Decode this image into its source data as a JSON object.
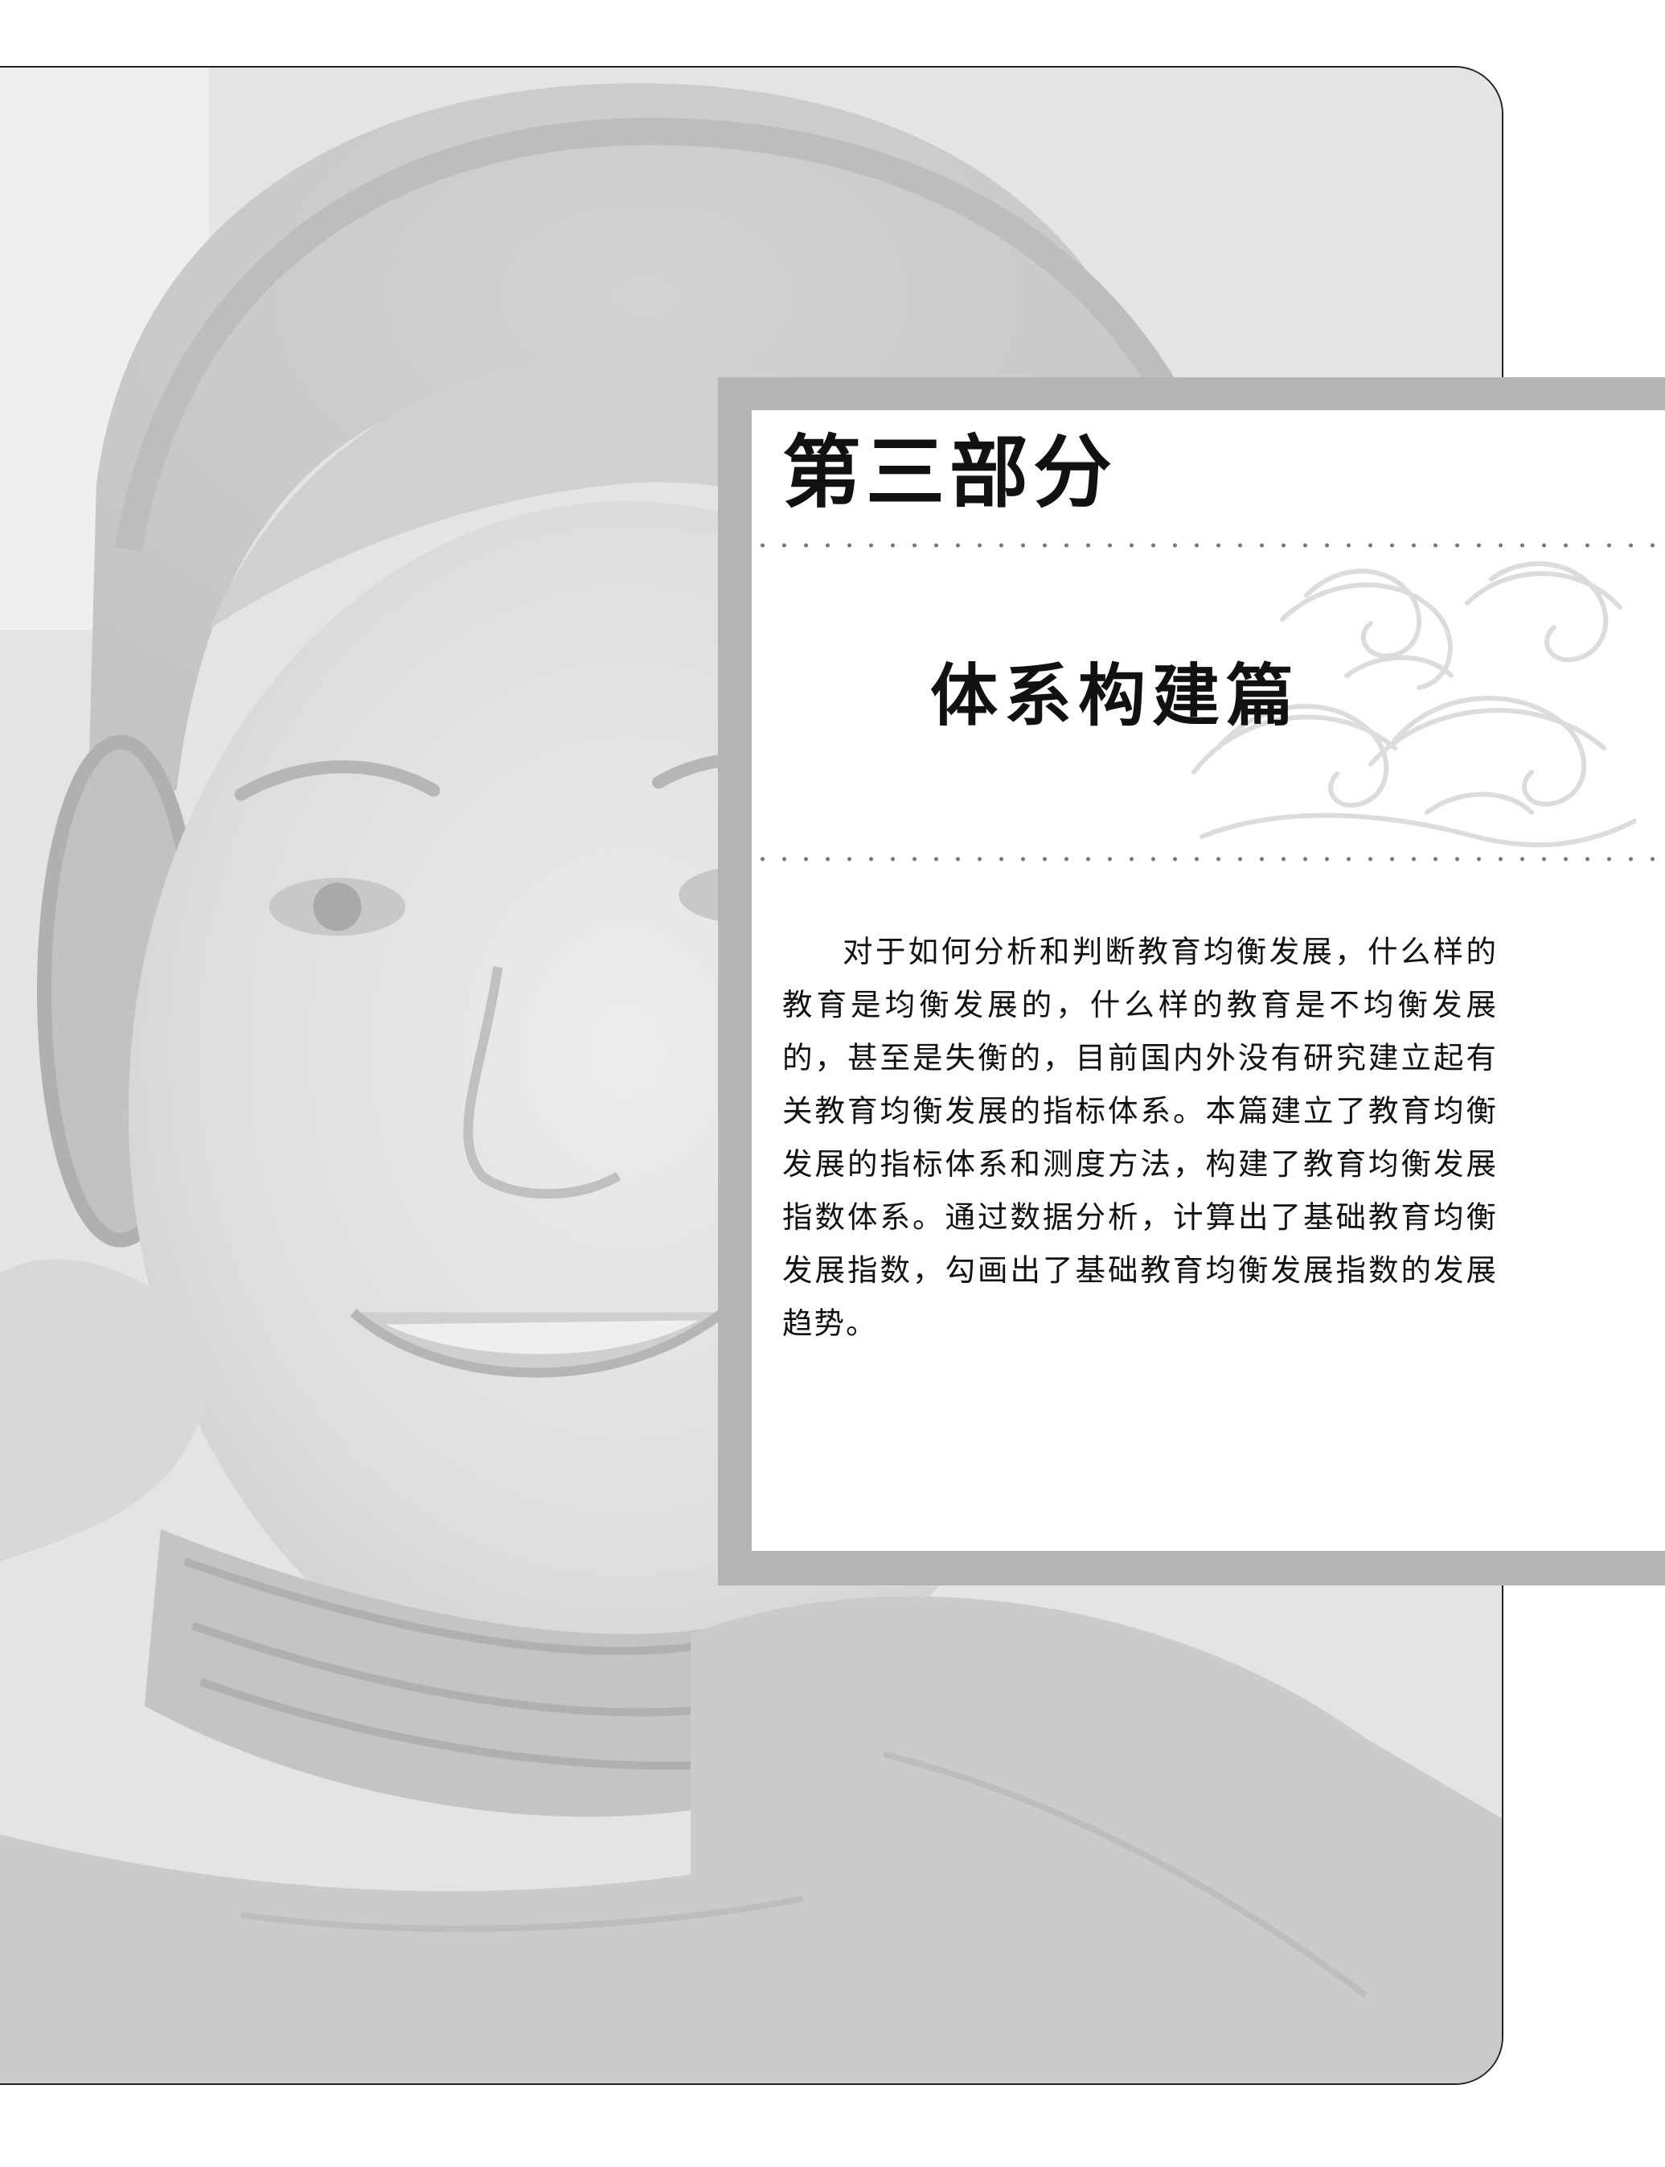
{
  "part_label": "第三部分",
  "section_title": "体系构建篇",
  "intro_text": "对于如何分析和判断教育均衡发展，什么样的教育是均衡发展的，什么样的教育是不均衡发展的，甚至是失衡的，目前国内外没有研究建立起有关教育均衡发展的指标体系。本篇建立了教育均衡发展的指标体系和测度方法，构建了教育均衡发展指数体系。通过数据分析，计算出了基础教育均衡发展指数，勾画出了基础教育均衡发展指数的发展趋势。",
  "photo": {
    "subject": "smiling girl wearing headphones"
  },
  "colors": {
    "frame_gray": "#b3b5b4",
    "text": "#111111"
  }
}
